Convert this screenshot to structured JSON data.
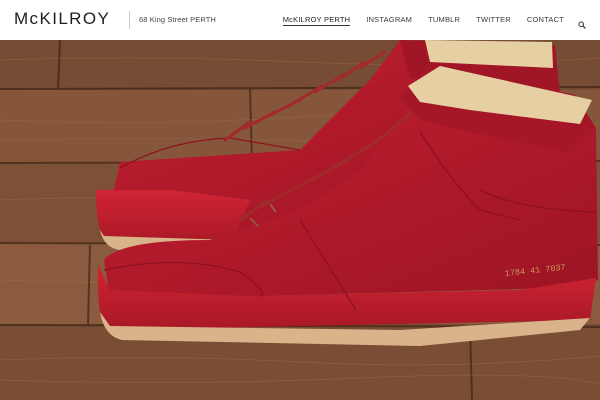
{
  "header": {
    "logo_text": "McKILROY",
    "address": "68 King Street PERTH"
  },
  "nav": {
    "items": [
      {
        "label": "McKILROY PERTH",
        "active": true
      },
      {
        "label": "INSTAGRAM",
        "active": false
      },
      {
        "label": "TUMBLR",
        "active": false
      },
      {
        "label": "TWITTER",
        "active": false
      },
      {
        "label": "CONTACT",
        "active": false
      }
    ],
    "search_icon": "search-icon"
  },
  "hero": {
    "image": "red-suede-high-top-sneakers-on-wood-floor",
    "shoe_serial": "1784 41 7037",
    "colors": {
      "suede": "#b3182a",
      "sole": "#c41d2c",
      "wood": "#8a5a3c",
      "gum": "#d9b48a",
      "lining": "#e7cfa4"
    }
  }
}
